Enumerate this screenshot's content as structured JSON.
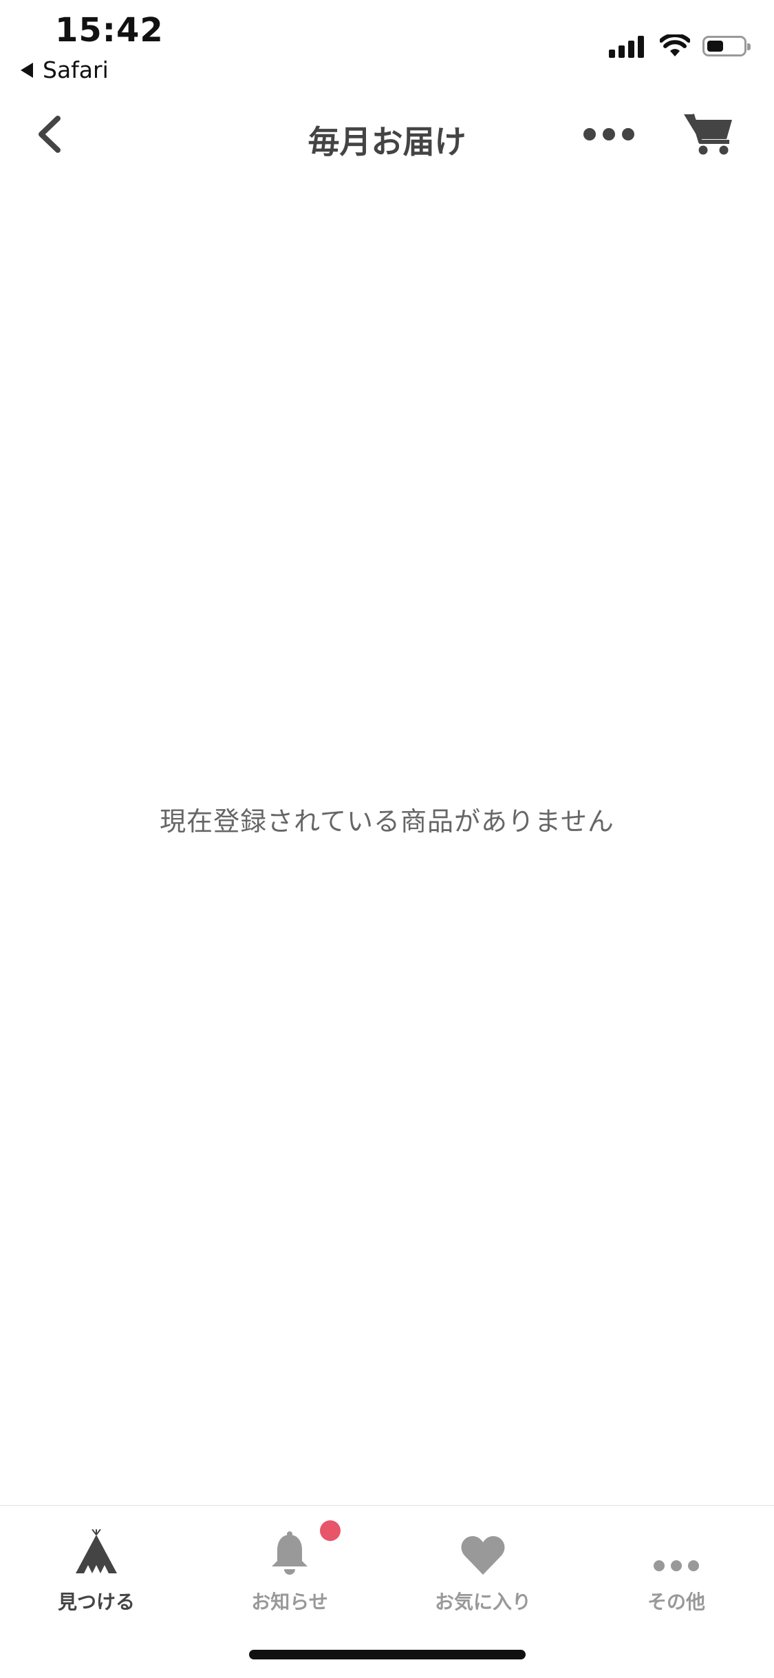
{
  "status_bar": {
    "time": "15:42",
    "back_app": "Safari",
    "battery_level": 0.45
  },
  "nav": {
    "title": "毎月お届け",
    "back_icon": "chevron-left-icon",
    "more_icon": "more-icon",
    "cart_icon": "cart-icon"
  },
  "main": {
    "empty_message": "現在登録されている商品がありません"
  },
  "tabs": [
    {
      "label": "見つける",
      "icon": "tent-icon",
      "active": true
    },
    {
      "label": "お知らせ",
      "icon": "bell-icon",
      "active": false,
      "badge": true
    },
    {
      "label": "お気に入り",
      "icon": "heart-icon",
      "active": false
    },
    {
      "label": "その他",
      "icon": "more-icon",
      "active": false
    }
  ],
  "colors": {
    "badge": "#e8546a",
    "active_tab": "#444444",
    "inactive_tab": "#999999",
    "title": "#444444"
  }
}
